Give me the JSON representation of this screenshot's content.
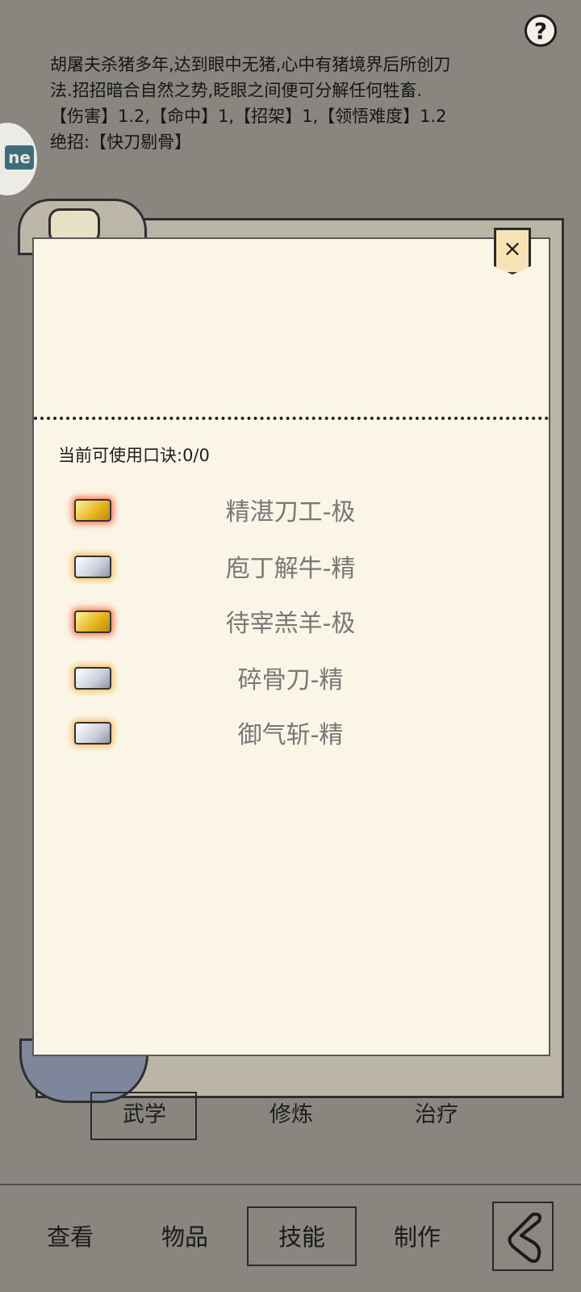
{
  "help": {
    "glyph": "?"
  },
  "description": {
    "line1": "胡屠夫杀猪多年,达到眼中无猪,心中有猪境界后所创刀",
    "line2": "法.招招暗合自然之势,眨眼之间便可分解任何牲畜.",
    "line3": "【伤害】1.2,【命中】1,【招架】1,【领悟难度】1.2",
    "line4": "绝招:【快刀剔骨】"
  },
  "side_tab": {
    "icon": "ne"
  },
  "panel": {
    "close_glyph": "×",
    "count_label": "当前可使用口诀:0/0",
    "skills": [
      {
        "name": "精湛刀工-极",
        "grade": "gold"
      },
      {
        "name": "庖丁解牛-精",
        "grade": "silver"
      },
      {
        "name": "待宰羔羊-极",
        "grade": "gold"
      },
      {
        "name": "碎骨刀-精",
        "grade": "silver"
      },
      {
        "name": "御气斩-精",
        "grade": "silver"
      }
    ]
  },
  "subtabs": {
    "wuxue": "武学",
    "xiulian": "修炼",
    "zhiliao": "治疗"
  },
  "nav": {
    "chakan": "查看",
    "wupin": "物品",
    "jineng": "技能",
    "zhizuo": "制作"
  },
  "colors": {
    "background": "#898680",
    "paper": "#faf5e6",
    "skill_text": "#787878"
  }
}
